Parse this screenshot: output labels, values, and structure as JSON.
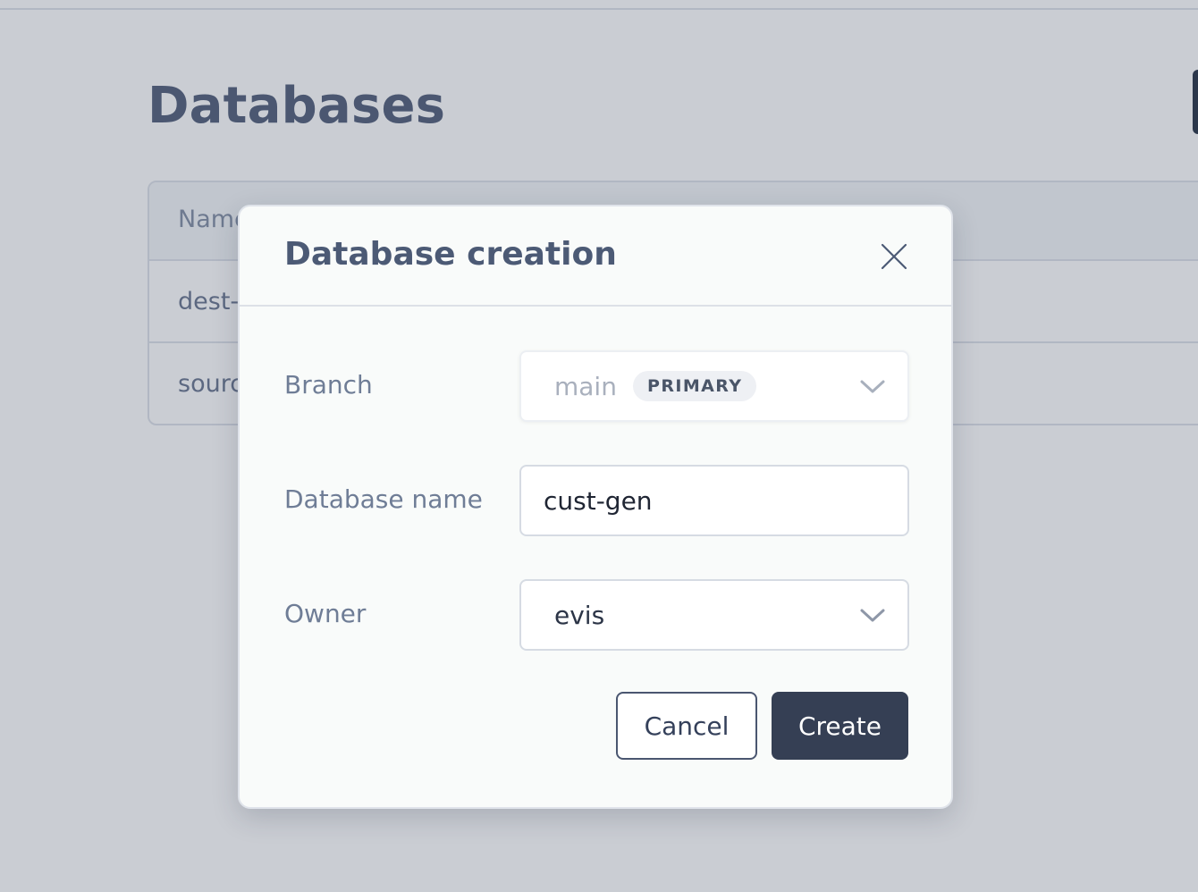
{
  "page": {
    "title": "Databases",
    "table": {
      "header": "Name",
      "rows": [
        "dest-",
        "sourc"
      ]
    }
  },
  "modal": {
    "title": "Database creation",
    "close_icon": "close-icon",
    "fields": {
      "branch": {
        "label": "Branch",
        "value": "main",
        "badge": "PRIMARY"
      },
      "database_name": {
        "label": "Database name",
        "value": "cust-gen"
      },
      "owner": {
        "label": "Owner",
        "value": "evis"
      }
    },
    "buttons": {
      "cancel": "Cancel",
      "create": "Create"
    }
  },
  "colors": {
    "primary_button": "#353f54",
    "overlay": "rgba(34,46,72,0.24)"
  }
}
